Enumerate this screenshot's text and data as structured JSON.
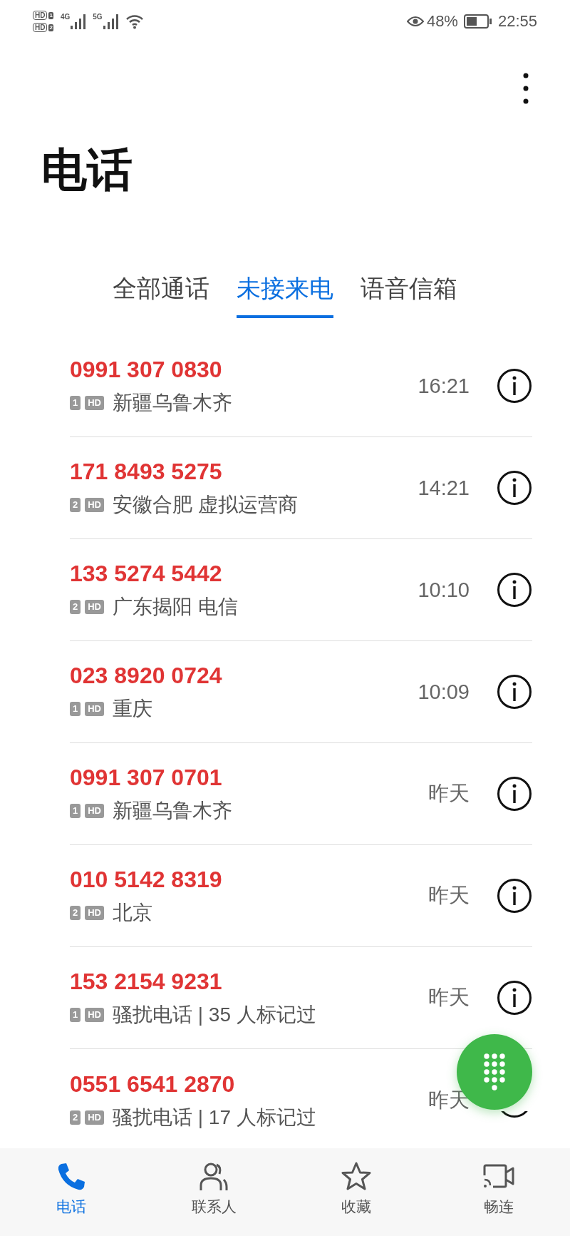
{
  "status_bar": {
    "sim_labels": [
      {
        "hd": "HD",
        "slot": "1"
      },
      {
        "hd": "HD",
        "slot": "2"
      }
    ],
    "networks": [
      "4G",
      "5G"
    ],
    "battery_percent": "48%",
    "time": "22:55"
  },
  "header": {
    "title": "电话"
  },
  "tabs": [
    {
      "label": "全部通话",
      "selected": false
    },
    {
      "label": "未接来电",
      "selected": true
    },
    {
      "label": "语音信箱",
      "selected": false
    }
  ],
  "calls": [
    {
      "number": "0991 307 0830",
      "sim": "1",
      "hd": "HD",
      "location": "新疆乌鲁木齐",
      "time": "16:21"
    },
    {
      "number": "171 8493 5275",
      "sim": "2",
      "hd": "HD",
      "location": "安徽合肥 虚拟运营商",
      "time": "14:21"
    },
    {
      "number": "133 5274 5442",
      "sim": "2",
      "hd": "HD",
      "location": "广东揭阳 电信",
      "time": "10:10"
    },
    {
      "number": "023 8920 0724",
      "sim": "1",
      "hd": "HD",
      "location": "重庆",
      "time": "10:09"
    },
    {
      "number": "0991 307 0701",
      "sim": "1",
      "hd": "HD",
      "location": "新疆乌鲁木齐",
      "time": "昨天"
    },
    {
      "number": "010 5142 8319",
      "sim": "2",
      "hd": "HD",
      "location": "北京",
      "time": "昨天"
    },
    {
      "number": "153 2154 9231",
      "sim": "1",
      "hd": "HD",
      "location": "骚扰电话 | 35 人标记过",
      "time": "昨天"
    },
    {
      "number": "0551 6541 2870",
      "sim": "2",
      "hd": "HD",
      "location": "骚扰电话 | 17 人标记过",
      "time": "昨天"
    }
  ],
  "bottom_nav": [
    {
      "label": "电话",
      "selected": true
    },
    {
      "label": "联系人",
      "selected": false
    },
    {
      "label": "收藏",
      "selected": false
    },
    {
      "label": "畅连",
      "selected": false
    }
  ]
}
